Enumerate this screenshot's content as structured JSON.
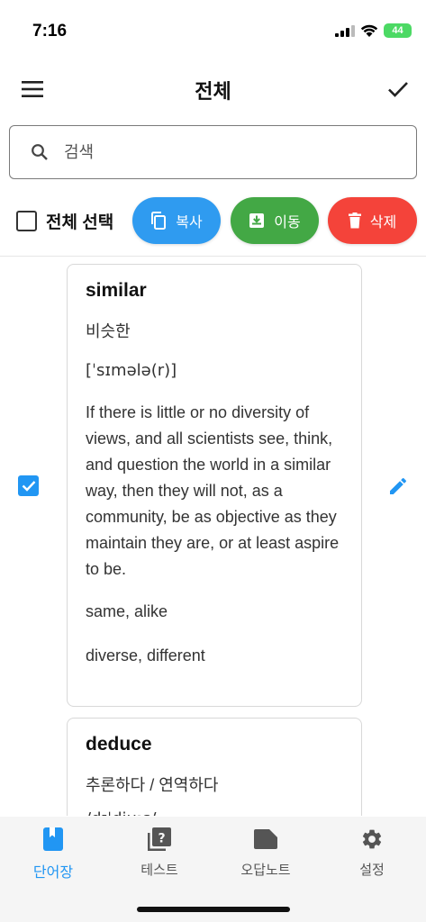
{
  "status": {
    "time": "7:16",
    "battery": "44"
  },
  "header": {
    "title": "전체"
  },
  "search": {
    "placeholder": "검색"
  },
  "actions": {
    "select_all": "전체 선택",
    "copy": "복사",
    "move": "이동",
    "delete": "삭제"
  },
  "colors": {
    "primary": "#2196f3",
    "copy": "#2f9bf0",
    "move": "#43a845",
    "delete": "#f4433a"
  },
  "cards": [
    {
      "word": "similar",
      "meaning": "비슷한",
      "pronunciation": "[ˈsɪmələ(r)]",
      "example": "If there is little or no diversity of views, and all scientists see, think, and question the world in a similar way, then they will not, as a community, be as objective as they maintain they are, or at least aspire to be.",
      "synonyms": "same, alike",
      "antonyms": "diverse, different",
      "checked": true
    },
    {
      "word": "deduce",
      "meaning": "추론하다 / 연역하다",
      "pronunciation": "/dɪˈdjuːs/"
    }
  ],
  "nav": [
    {
      "label": "단어장",
      "icon": "bookmark-book-icon",
      "active": true
    },
    {
      "label": "테스트",
      "icon": "quiz-icon",
      "active": false
    },
    {
      "label": "오답노트",
      "icon": "label-note-icon",
      "active": false
    },
    {
      "label": "설정",
      "icon": "gear-icon",
      "active": false
    }
  ]
}
